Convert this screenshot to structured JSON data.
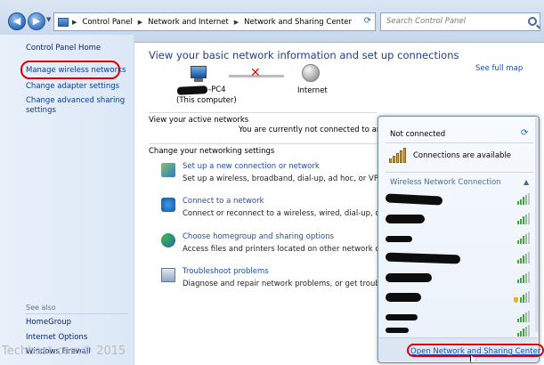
{
  "address_bar": {
    "crumbs": [
      "Control Panel",
      "Network and Internet",
      "Network and Sharing Center"
    ],
    "search_placeholder": "Search Control Panel"
  },
  "left_pane": {
    "home": "Control Panel Home",
    "links": [
      "Manage wireless networks",
      "Change adapter settings",
      "Change advanced sharing",
      "settings"
    ],
    "see_also_title": "See also",
    "see_also": [
      "HomeGroup",
      "Internet Options",
      "Windows Firewall"
    ]
  },
  "main": {
    "title": "View your basic network information and set up connections",
    "see_full_map": "See full map",
    "computer_name_suffix": "-PC4",
    "computer_sub": "(This computer)",
    "internet_label": "Internet",
    "active_networks_label": "View your active networks",
    "not_connected_message": "You are currently not connected to an",
    "change_settings_label": "Change your networking settings",
    "tasks": [
      {
        "link": "Set up a new connection or network",
        "desc": "Set up a wireless, broadband, dial-up, ad hoc, or VPN conne"
      },
      {
        "link": "Connect to a network",
        "desc": "Connect or reconnect to a wireless, wired, dial-up, or VPN"
      },
      {
        "link": "Choose homegroup and sharing options",
        "desc": "Access files and printers located on other network compu"
      },
      {
        "link": "Troubleshoot problems",
        "desc": "Diagnose and repair network problems, or get troublesho"
      }
    ]
  },
  "popup": {
    "status": "Not connected",
    "connections_available": "Connections are available",
    "section": "Wireless Network Connection",
    "open_link": "Open Network and Sharing Center",
    "networks": [
      {
        "secured": false
      },
      {
        "secured": false
      },
      {
        "secured": false
      },
      {
        "secured": false
      },
      {
        "secured": false
      },
      {
        "secured": true
      },
      {
        "secured": false
      },
      {
        "secured": false
      }
    ]
  },
  "watermark": "Techbast.com© 2015",
  "colors": {
    "accent_link": "#1e4da8",
    "highlight_red": "#e00000",
    "title_blue": "#1d3d8f"
  }
}
